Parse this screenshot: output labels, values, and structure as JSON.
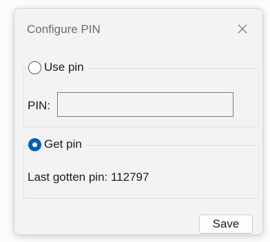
{
  "dialog": {
    "title": "Configure PIN",
    "close_icon": "close-icon"
  },
  "use_pin": {
    "label": "Use pin",
    "selected": false,
    "pin_label": "PIN:",
    "pin_value": ""
  },
  "get_pin": {
    "label": "Get pin",
    "selected": true,
    "last_label": "Last gotten pin: 112797"
  },
  "footer": {
    "save_label": "Save"
  },
  "colors": {
    "accent": "#005fb8"
  }
}
